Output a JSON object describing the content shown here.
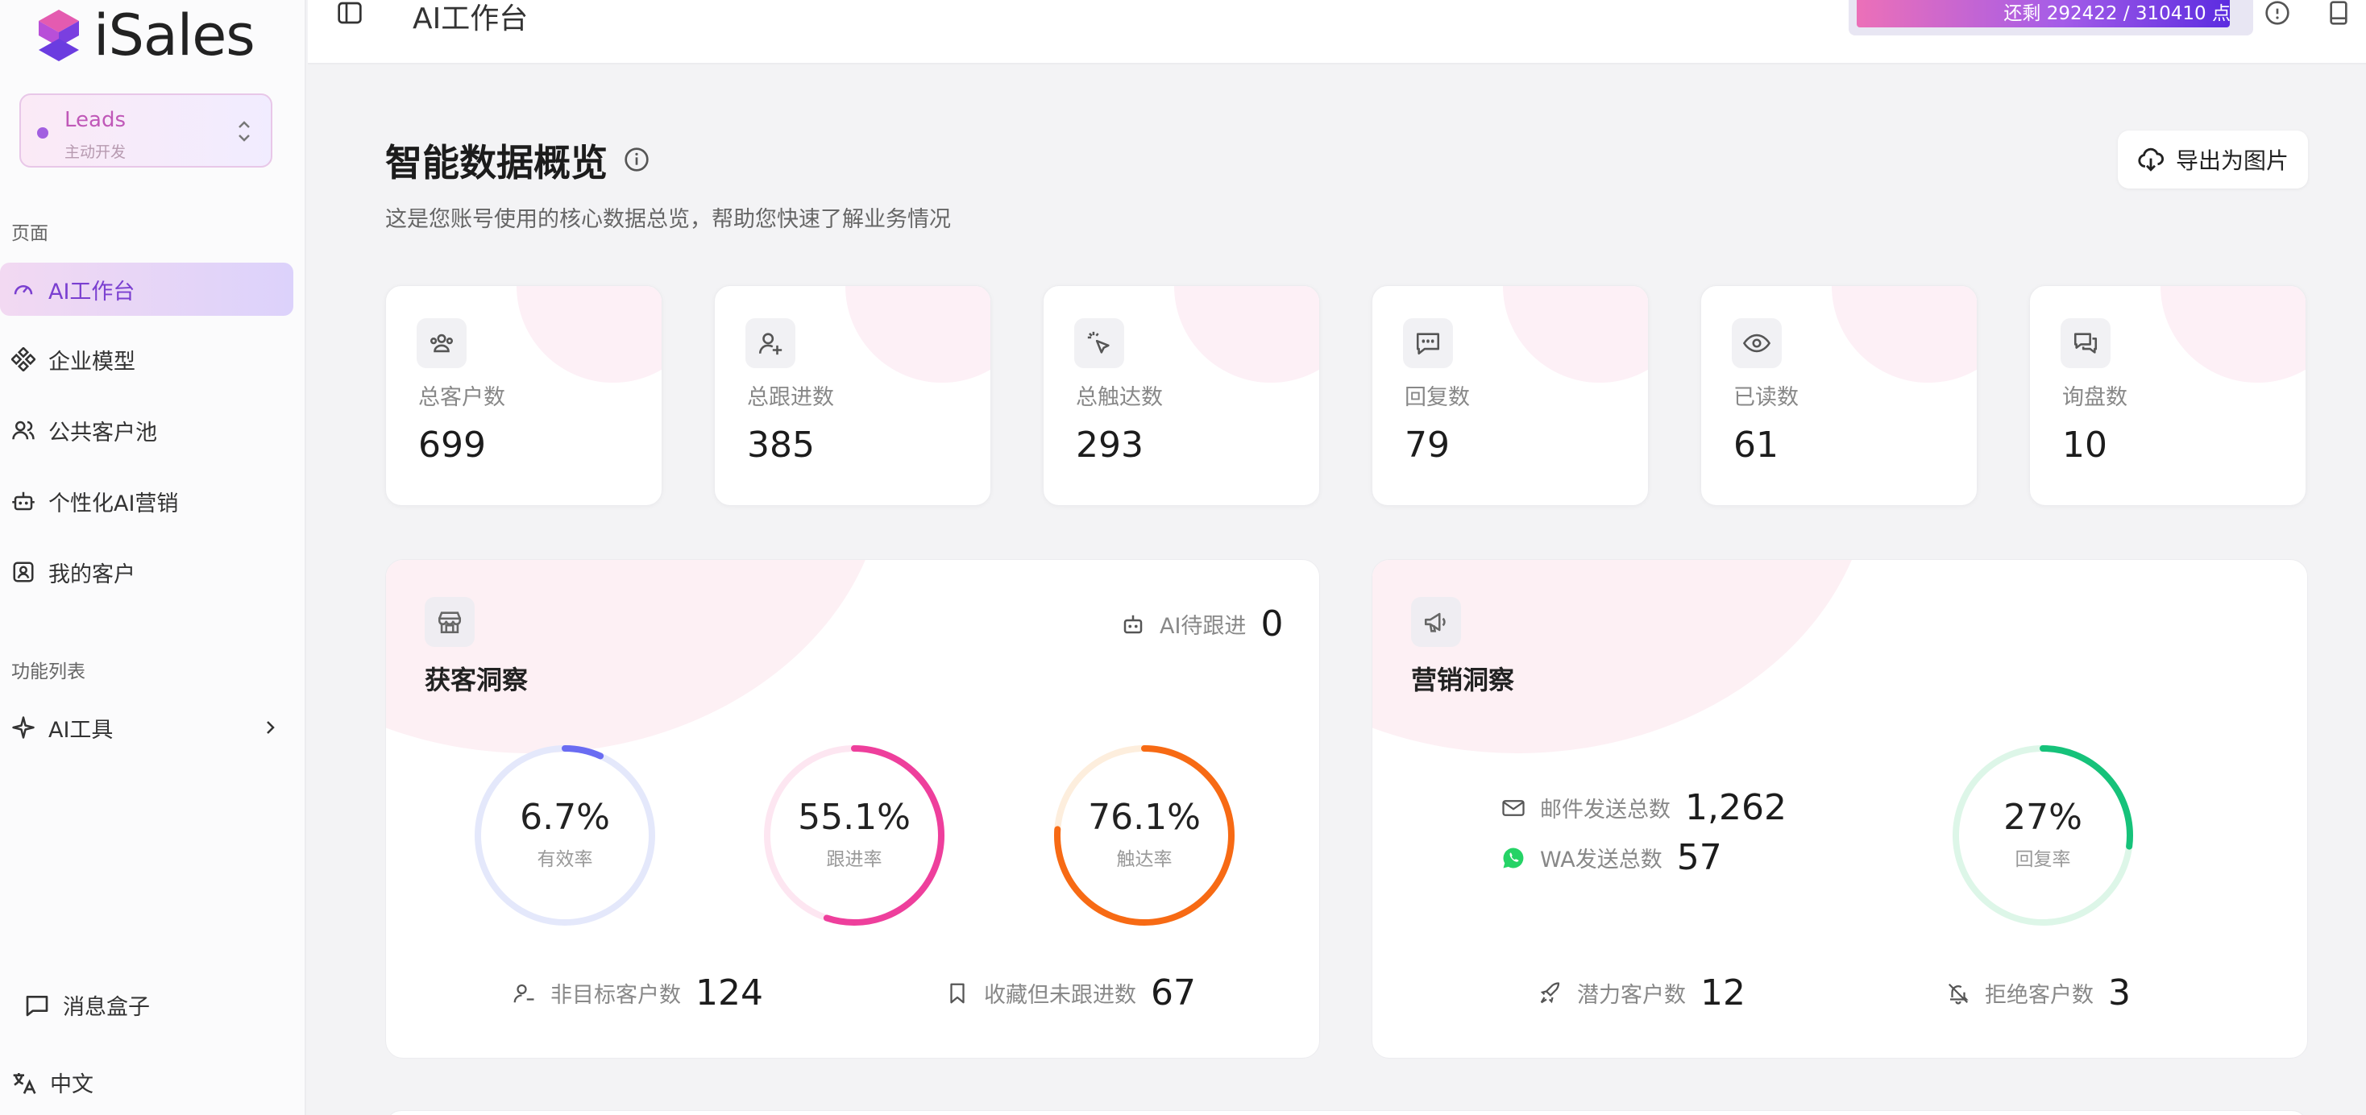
{
  "app": {
    "name": "iSales"
  },
  "workspace": {
    "name": "Leads",
    "subtitle": "主动开发"
  },
  "sidebar": {
    "section_pages": "页面",
    "items": [
      {
        "label": "AI工作台",
        "icon": "gauge-icon",
        "active": true
      },
      {
        "label": "企业模型",
        "icon": "nodes-icon"
      },
      {
        "label": "公共客户池",
        "icon": "users-icon"
      },
      {
        "label": "个性化AI营销",
        "icon": "robot-icon"
      },
      {
        "label": "我的客户",
        "icon": "contact-icon"
      }
    ],
    "section_features": "功能列表",
    "tools": {
      "label": "AI工具",
      "icon": "sparkle-icon"
    },
    "inbox": "消息盒子",
    "language": "中文"
  },
  "topbar": {
    "crumb": "AI工作台",
    "quota_text": "还剩 292422 / 310410 点",
    "quota_fraction": 0.942
  },
  "main": {
    "title": "智能数据概览",
    "subtitle": "这是您账号使用的核心数据总览，帮助您快速了解业务情况",
    "export_label": "导出为图片"
  },
  "stats": [
    {
      "label": "总客户数",
      "value": "699",
      "icon": "users-group-icon"
    },
    {
      "label": "总跟进数",
      "value": "385",
      "icon": "user-add-icon"
    },
    {
      "label": "总触达数",
      "value": "293",
      "icon": "cursor-click-icon"
    },
    {
      "label": "回复数",
      "value": "79",
      "icon": "chat-icon"
    },
    {
      "label": "已读数",
      "value": "61",
      "icon": "eye-icon"
    },
    {
      "label": "询盘数",
      "value": "10",
      "icon": "messages-icon"
    }
  ],
  "acquisition": {
    "title": "获客洞察",
    "ai_pending_label": "AI待跟进",
    "ai_pending_value": "0",
    "rings": [
      {
        "pct": "6.7%",
        "fraction": 0.067,
        "label": "有效率",
        "color": "#6a6cf2",
        "track": "#e4e8fb"
      },
      {
        "pct": "55.1%",
        "fraction": 0.551,
        "label": "跟进率",
        "color": "#ee3f9c",
        "track": "#fde6f1"
      },
      {
        "pct": "76.1%",
        "fraction": 0.761,
        "label": "触达率",
        "color": "#f76a14",
        "track": "#fdeedd"
      }
    ],
    "non_target_label": "非目标客户数",
    "non_target_value": "124",
    "favorited_label": "收藏但未跟进数",
    "favorited_value": "67"
  },
  "marketing": {
    "title": "营销洞察",
    "email_label": "邮件发送总数",
    "email_value": "1,262",
    "wa_label": "WA发送总数",
    "wa_value": "57",
    "ring": {
      "pct": "27%",
      "fraction": 0.27,
      "label": "回复率",
      "color": "#16c27a",
      "track": "#ddf6e8"
    },
    "potential_label": "潜力客户数",
    "potential_value": "12",
    "rejected_label": "拒绝客户数",
    "rejected_value": "3"
  }
}
